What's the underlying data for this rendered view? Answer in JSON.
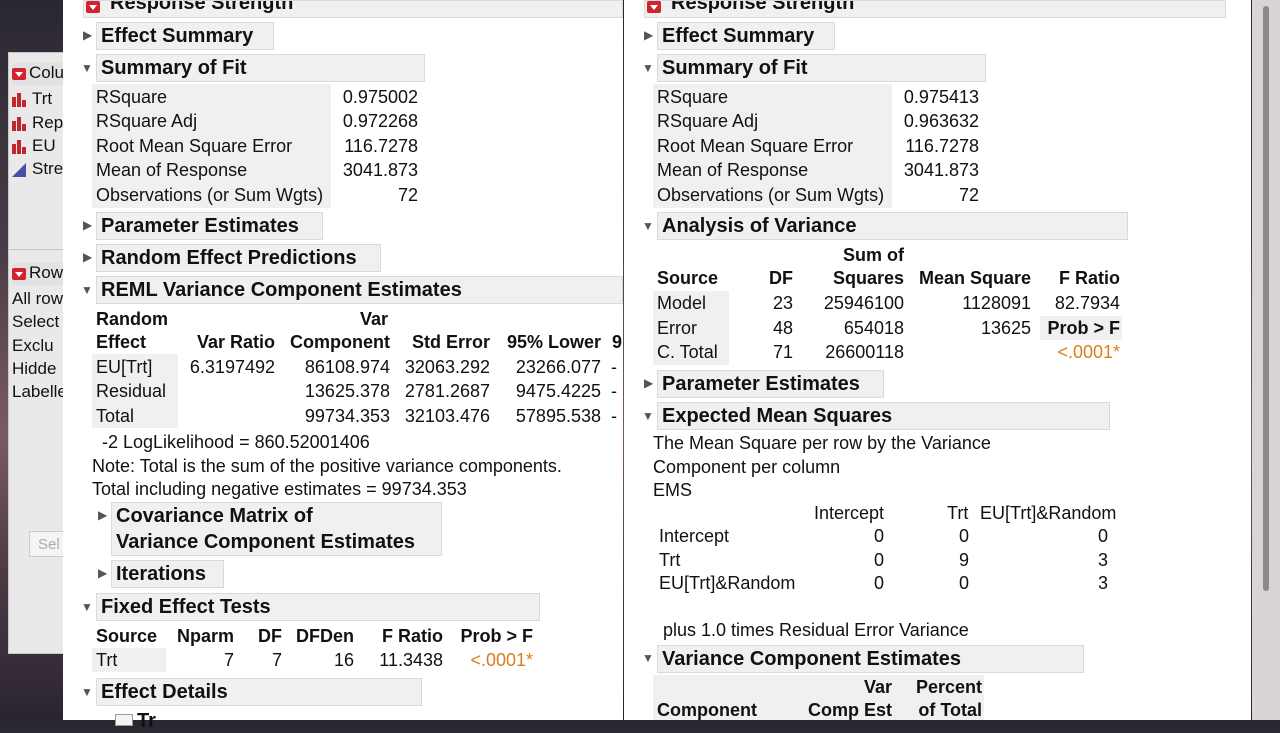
{
  "background_window": {
    "column_header": "Colu",
    "columns": [
      "Trt",
      "Rep",
      "EU",
      "Stre"
    ],
    "rows_header": "Row",
    "row_states": [
      "All row",
      "Select",
      "Exclu",
      "Hidde",
      "Labelle"
    ],
    "bottom_field": "Sel"
  },
  "left_report": {
    "title": "Response Strength",
    "effect_summary": "Effect Summary",
    "summary_of_fit": {
      "title": "Summary of Fit",
      "rows": [
        {
          "label": "RSquare",
          "value": "0.975002"
        },
        {
          "label": "RSquare Adj",
          "value": "0.972268"
        },
        {
          "label": "Root Mean Square Error",
          "value": "116.7278"
        },
        {
          "label": "Mean of Response",
          "value": "3041.873"
        },
        {
          "label": "Observations (or Sum Wgts)",
          "value": "72"
        }
      ]
    },
    "parameter_estimates": "Parameter Estimates",
    "random_effect_predictions": "Random Effect Predictions",
    "reml": {
      "title": "REML Variance Component Estimates",
      "header_top": {
        "random": "Random",
        "var": "Var"
      },
      "headers": [
        "Effect",
        "Var Ratio",
        "Component",
        "Std Error",
        "95% Lower",
        "9"
      ],
      "rows": [
        [
          "EU[Trt]",
          "6.3197492",
          "86108.974",
          "32063.292",
          "23266.077",
          "-"
        ],
        [
          "Residual",
          "",
          "13625.378",
          "2781.2687",
          "9475.4225",
          "-"
        ],
        [
          "Total",
          "",
          "99734.353",
          "32103.476",
          "57895.538",
          "-"
        ]
      ],
      "loglik": "-2 LogLikelihood =  860.52001406",
      "note": "Note: Total is the sum of the positive variance components.",
      "neg_total": "Total including negative estimates =  99734.353"
    },
    "covariance_matrix": [
      "Covariance Matrix of",
      "Variance Component Estimates"
    ],
    "iterations": "Iterations",
    "fixed_effect_tests": {
      "title": "Fixed Effect Tests",
      "headers": [
        "Source",
        "Nparm",
        "DF",
        "DFDen",
        "F Ratio",
        "Prob > F"
      ],
      "row": [
        "Trt",
        "7",
        "7",
        "16",
        "11.3438",
        "<.0001*"
      ]
    },
    "effect_details": "Effect Details",
    "partial_item": "Tr"
  },
  "right_report": {
    "title": "Response Strength",
    "effect_summary": "Effect Summary",
    "summary_of_fit": {
      "title": "Summary of Fit",
      "rows": [
        {
          "label": "RSquare",
          "value": "0.975413"
        },
        {
          "label": "RSquare Adj",
          "value": "0.963632"
        },
        {
          "label": "Root Mean Square Error",
          "value": "116.7278"
        },
        {
          "label": "Mean of Response",
          "value": "3041.873"
        },
        {
          "label": "Observations (or Sum Wgts)",
          "value": "72"
        }
      ]
    },
    "anova": {
      "title": "Analysis of Variance",
      "sum_of": "Sum of",
      "headers": [
        "Source",
        "DF",
        "Squares",
        "Mean Square",
        "F Ratio"
      ],
      "rows": [
        [
          "Model",
          "23",
          "25946100",
          "1128091",
          "82.7934"
        ],
        [
          "Error",
          "48",
          "654018",
          "13625",
          "Prob > F"
        ],
        [
          "C. Total",
          "71",
          "26600118",
          "",
          "<.0001*"
        ]
      ]
    },
    "parameter_estimates": "Parameter Estimates",
    "ems": {
      "title": "Expected Mean Squares",
      "desc1": "The Mean Square per row by the Variance",
      "desc2": "Component per column",
      "ems_label": "EMS",
      "col_headers": [
        "Intercept",
        "Trt",
        "EU[Trt]&Random"
      ],
      "rows": [
        [
          "Intercept",
          "0",
          "0",
          "0"
        ],
        [
          "Trt",
          "0",
          "9",
          "3"
        ],
        [
          "EU[Trt]&Random",
          "0",
          "0",
          "3"
        ]
      ],
      "plus": "plus 1.0 times Residual Error Variance"
    },
    "vce": {
      "title": "Variance Component Estimates",
      "h_var": "Var",
      "h_percent": "Percent",
      "headers": [
        "Component",
        "Comp Est",
        "of Total"
      ]
    }
  }
}
